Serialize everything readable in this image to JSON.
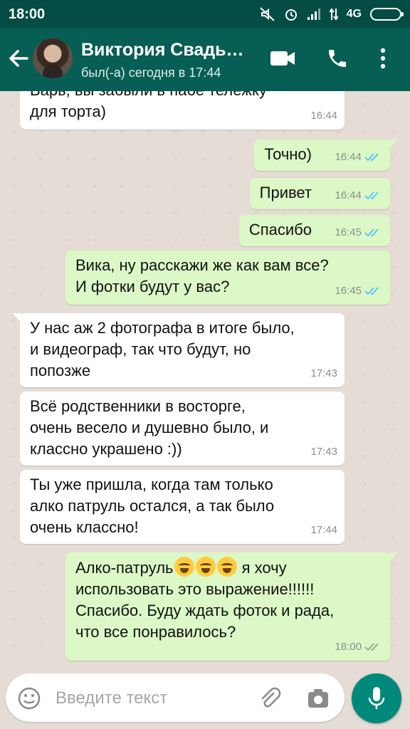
{
  "status_bar": {
    "time": "18:00",
    "network": "4G",
    "icons": [
      "mute-icon",
      "alarm-icon",
      "signal-icon",
      "data-arrows-icon",
      "battery-icon"
    ]
  },
  "header": {
    "contact_name": "Виктория Свадь…",
    "last_seen": "был(-а) сегодня в 17:44",
    "icons": [
      "back-arrow-icon",
      "video-call-icon",
      "phone-icon",
      "more-vert-icon"
    ],
    "color": "#075e54"
  },
  "messages": [
    {
      "dir": "in",
      "text": "Варь, вы забыли в пабе тележку\nдля торта)",
      "time": "16:44"
    },
    {
      "dir": "out",
      "text": "Точно)",
      "time": "16:44",
      "status": "read"
    },
    {
      "dir": "out",
      "text": "Привет",
      "time": "16:44",
      "status": "read"
    },
    {
      "dir": "out",
      "text": "Спасибо",
      "time": "16:45",
      "status": "read"
    },
    {
      "dir": "out",
      "text": "Вика, ну расскажи же как вам все?\nИ фотки будут у вас?",
      "time": "16:45",
      "status": "read"
    },
    {
      "dir": "in",
      "text": "У нас аж 2 фотографа в итоге было,\nи видеограф, так что будут, но\nпопозже",
      "time": "17:43"
    },
    {
      "dir": "in",
      "text": "Всё родственники в восторге,\nочень весело и душевно было, и\nклассно украшено :))",
      "time": "17:43"
    },
    {
      "dir": "in",
      "text": "Ты уже пришла, когда там только\nалко патруль остался, а так было\nочень классно!",
      "time": "17:44"
    },
    {
      "dir": "out",
      "text_before_emoji": "Алко-патруль",
      "emoji": [
        "rolling-on-floor-laughing-emoji",
        "rolling-on-floor-laughing-emoji",
        "rolling-on-floor-laughing-emoji"
      ],
      "text_after_emoji": " я хочу\nиспользовать это выражение!!!!!!\nСпасибо. Буду ждать фоток и рада,\nчто все понравилось?",
      "time": "18:00",
      "status": "delivered"
    }
  ],
  "input_bar": {
    "placeholder": "Введите текст",
    "icons": [
      "emoji-icon",
      "attach-icon",
      "camera-icon",
      "mic-icon"
    ]
  },
  "colors": {
    "status_bar": "#054d44",
    "outgoing_bubble": "#dcf8c6",
    "incoming_bubble": "#ffffff",
    "read_ticks": "#4fc3f7",
    "mic_button": "#00897b"
  }
}
